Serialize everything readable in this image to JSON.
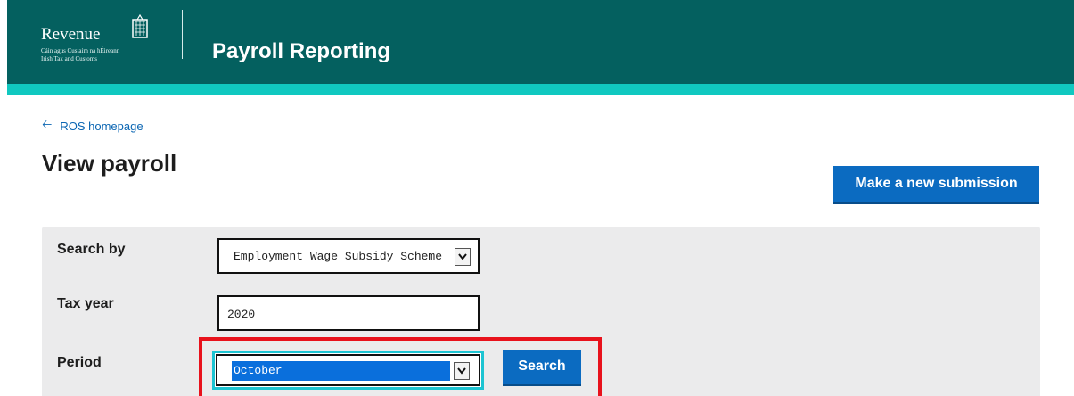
{
  "header": {
    "logo": {
      "wordmark": "Revenue",
      "line1": "Cáin agus Custaim na hÉireann",
      "line2": "Irish Tax and Customs"
    },
    "app_title": "Payroll Reporting"
  },
  "nav": {
    "back_label": "ROS homepage"
  },
  "page": {
    "title": "View payroll",
    "new_submission_label": "Make a new submission"
  },
  "form": {
    "search_by": {
      "label": "Search by",
      "value": "Employment Wage Subsidy Scheme"
    },
    "tax_year": {
      "label": "Tax year",
      "value": "2020"
    },
    "period": {
      "label": "Period",
      "value": "October"
    },
    "search_label": "Search"
  },
  "colors": {
    "header": "#04605f",
    "header_accent": "#10c8c0",
    "primary_button": "#0b6bc1",
    "link": "#0b66b3",
    "panel": "#ebebec",
    "highlight": "#e8121c",
    "focus_ring": "#1cc4d2"
  },
  "icons": {
    "back": "arrow-left-icon",
    "dropdown": "chevron-down-icon",
    "logo": "harp-icon"
  }
}
